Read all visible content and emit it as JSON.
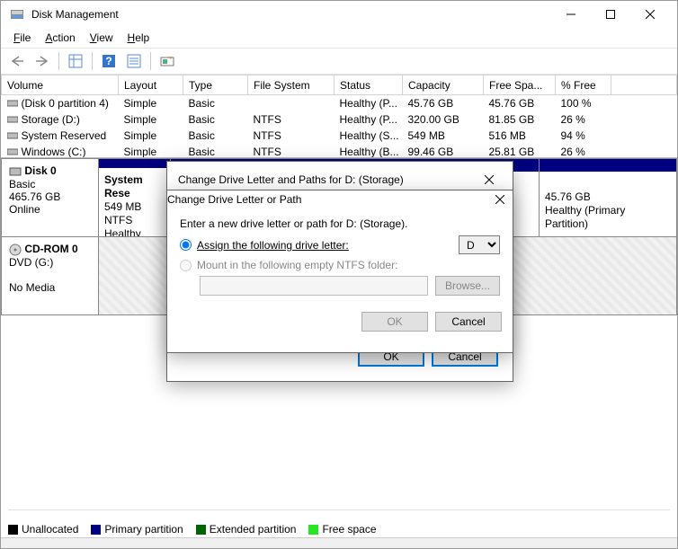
{
  "window": {
    "title": "Disk Management"
  },
  "menu": {
    "file": "File",
    "action": "Action",
    "view": "View",
    "help": "Help"
  },
  "columns": [
    "Volume",
    "Layout",
    "Type",
    "File System",
    "Status",
    "Capacity",
    "Free Spa...",
    "% Free"
  ],
  "volumes": [
    {
      "name": "(Disk 0 partition 4)",
      "layout": "Simple",
      "type": "Basic",
      "fs": "",
      "status": "Healthy (P...",
      "capacity": "45.76 GB",
      "free": "45.76 GB",
      "pct": "100 %"
    },
    {
      "name": "Storage (D:)",
      "layout": "Simple",
      "type": "Basic",
      "fs": "NTFS",
      "status": "Healthy (P...",
      "capacity": "320.00 GB",
      "free": "81.85 GB",
      "pct": "26 %"
    },
    {
      "name": "System Reserved",
      "layout": "Simple",
      "type": "Basic",
      "fs": "NTFS",
      "status": "Healthy (S...",
      "capacity": "549 MB",
      "free": "516 MB",
      "pct": "94 %"
    },
    {
      "name": "Windows (C:)",
      "layout": "Simple",
      "type": "Basic",
      "fs": "NTFS",
      "status": "Healthy (B...",
      "capacity": "99.46 GB",
      "free": "25.81 GB",
      "pct": "26 %"
    }
  ],
  "disk0": {
    "name": "Disk 0",
    "type": "Basic",
    "size": "465.76 GB",
    "status": "Online",
    "region1": {
      "title": "System Rese",
      "line2": "549 MB NTFS",
      "line3": "Healthy (Syste"
    },
    "region2": {
      "size": "45.76 GB",
      "status": "Healthy (Primary Partition)"
    }
  },
  "cdrom": {
    "name": "CD-ROM 0",
    "type": "DVD (G:)",
    "status": "No Media"
  },
  "legend": {
    "unalloc": "Unallocated",
    "primary": "Primary partition",
    "extended": "Extended partition",
    "free": "Free space"
  },
  "dialog1": {
    "title": "Change Drive Letter and Paths for D: (Storage)",
    "ok": "OK",
    "cancel": "Cancel"
  },
  "dialog2": {
    "title": "Change Drive Letter or Path",
    "instruction": "Enter a new drive letter or path for D: (Storage).",
    "opt_assign": "Assign the following drive letter:",
    "opt_mount": "Mount in the following empty NTFS folder:",
    "drive": "D",
    "browse": "Browse...",
    "ok": "OK",
    "cancel": "Cancel"
  }
}
